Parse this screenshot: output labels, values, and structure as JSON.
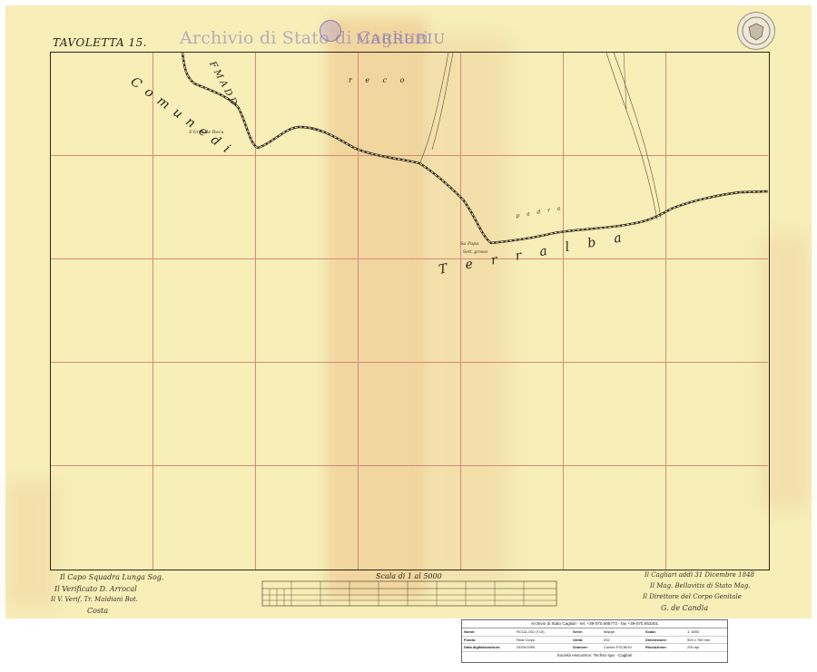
{
  "sheet": {
    "tavoletta_label": "TAVOLETTA 15.",
    "archive_stamp": "Archivio di Stato di Cagliari",
    "place_title": "MARRUBIU"
  },
  "map_labels": {
    "comune_left": "C o m u n e   d i",
    "comune_terralba": "T e r r a l b a",
    "top_letters": "F M A D D",
    "dots": "r   e   c   o",
    "riu_label": "S'Grtu de Rocu",
    "sa_papa": "Sa Papa",
    "sa_papa_sub": "Sett. grosso",
    "river_text_1": "p a d r a"
  },
  "scale": {
    "label": "Scala di 1 al 5000"
  },
  "signatures": {
    "left": [
      "Il Capo Squadra Lunga Sog.",
      "Il Verificato D. Arrocal",
      "Il V. Verif. Tr. Maldiani Bot.",
      "Costa"
    ],
    "right": [
      "Il Cagliari addì 31 Dicembre 1848",
      "Il Mag. Bellavitis di Stato Mag.",
      "Il Direttore del Corpo Genitale",
      "G. de Candia"
    ]
  },
  "info_box": {
    "header": "Archivio di Stato Cagliari - tel. +39-070.665772 - fax +39-070.653401",
    "rows": [
      {
        "k1": "Nome:",
        "v1": "RC111-032 (T15)",
        "k2": "Serie:",
        "v2": "Mappe",
        "k3": "Scala:",
        "v3": "1: 5000"
      },
      {
        "k1": "Fondo:",
        "v1": "Real Corpo",
        "k2": "Unità:",
        "v2": "032",
        "k3": "Dimensione:",
        "v3": "504 x 780 mm"
      },
      {
        "k1": "Data digitalizzazione:",
        "v1": "24/09/1999",
        "k2": "Scanner:",
        "v2": "Contex FSC8010",
        "k3": "Risoluzione:",
        "v3": "200 dpi"
      }
    ],
    "footer": "Società esecutrice: Techso spa - Cagliari"
  },
  "colors": {
    "paper": "#f7eeb8",
    "grid": "#d68a7a",
    "ink": "#2a241c"
  }
}
